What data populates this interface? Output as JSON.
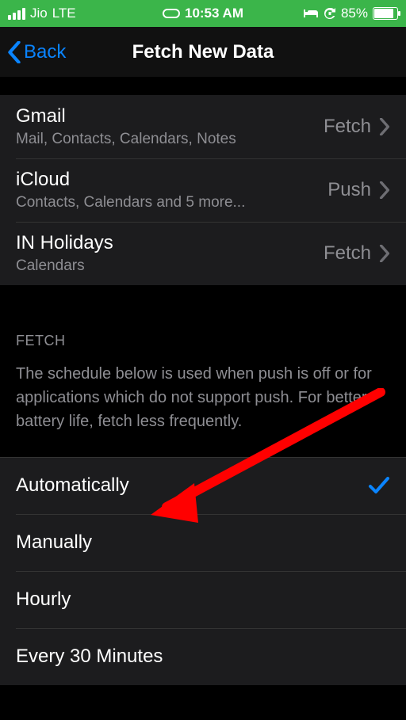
{
  "status": {
    "carrier": "Jio",
    "network": "LTE",
    "time": "10:53 AM",
    "battery_pct": "85%",
    "battery_fill_pct": 85
  },
  "nav": {
    "back_label": "Back",
    "title": "Fetch New Data"
  },
  "accounts": [
    {
      "name": "Gmail",
      "sub": "Mail, Contacts, Calendars, Notes",
      "mode": "Fetch"
    },
    {
      "name": "iCloud",
      "sub": "Contacts, Calendars and 5 more...",
      "mode": "Push"
    },
    {
      "name": "IN Holidays",
      "sub": "Calendars",
      "mode": "Fetch"
    }
  ],
  "fetch_section": {
    "header": "FETCH",
    "footer": "The schedule below is used when push is off or for applications which do not support push. For better battery life, fetch less frequently."
  },
  "fetch_options": [
    {
      "label": "Automatically",
      "selected": true
    },
    {
      "label": "Manually",
      "selected": false
    },
    {
      "label": "Hourly",
      "selected": false
    },
    {
      "label": "Every 30 Minutes",
      "selected": false
    }
  ],
  "annotation": {
    "arrow_color": "#ff0000"
  }
}
